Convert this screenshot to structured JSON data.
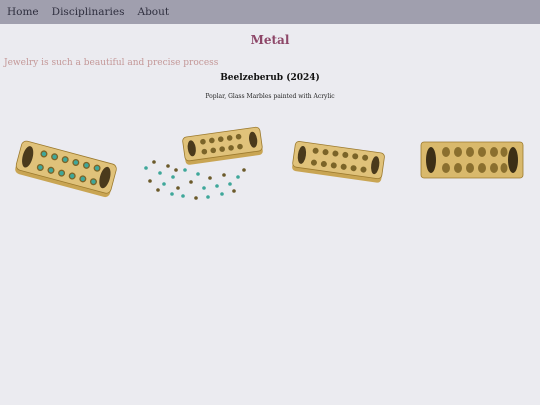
{
  "nav": {
    "home": "Home",
    "disciplinaries": "Disciplinaries",
    "about": "About"
  },
  "page": {
    "title": "Metal",
    "intro": "Jewelry is such a beautiful and precise process"
  },
  "work": {
    "title": "Beelzeberub (2024)",
    "medium": "Poplar, Glass Marbles painted with Acrylic"
  },
  "colors": {
    "nav_bg": "#a09fae",
    "title": "#8d4668",
    "intro": "#c49898",
    "wood": "#d9b96c",
    "marble_teal": "#3fa79a"
  },
  "gallery": {
    "images": [
      {
        "icon": "mancala-board-angled-photo"
      },
      {
        "icon": "mancala-board-scattered-marbles-photo"
      },
      {
        "icon": "mancala-board-side-photo"
      },
      {
        "icon": "mancala-board-front-photo"
      }
    ]
  }
}
